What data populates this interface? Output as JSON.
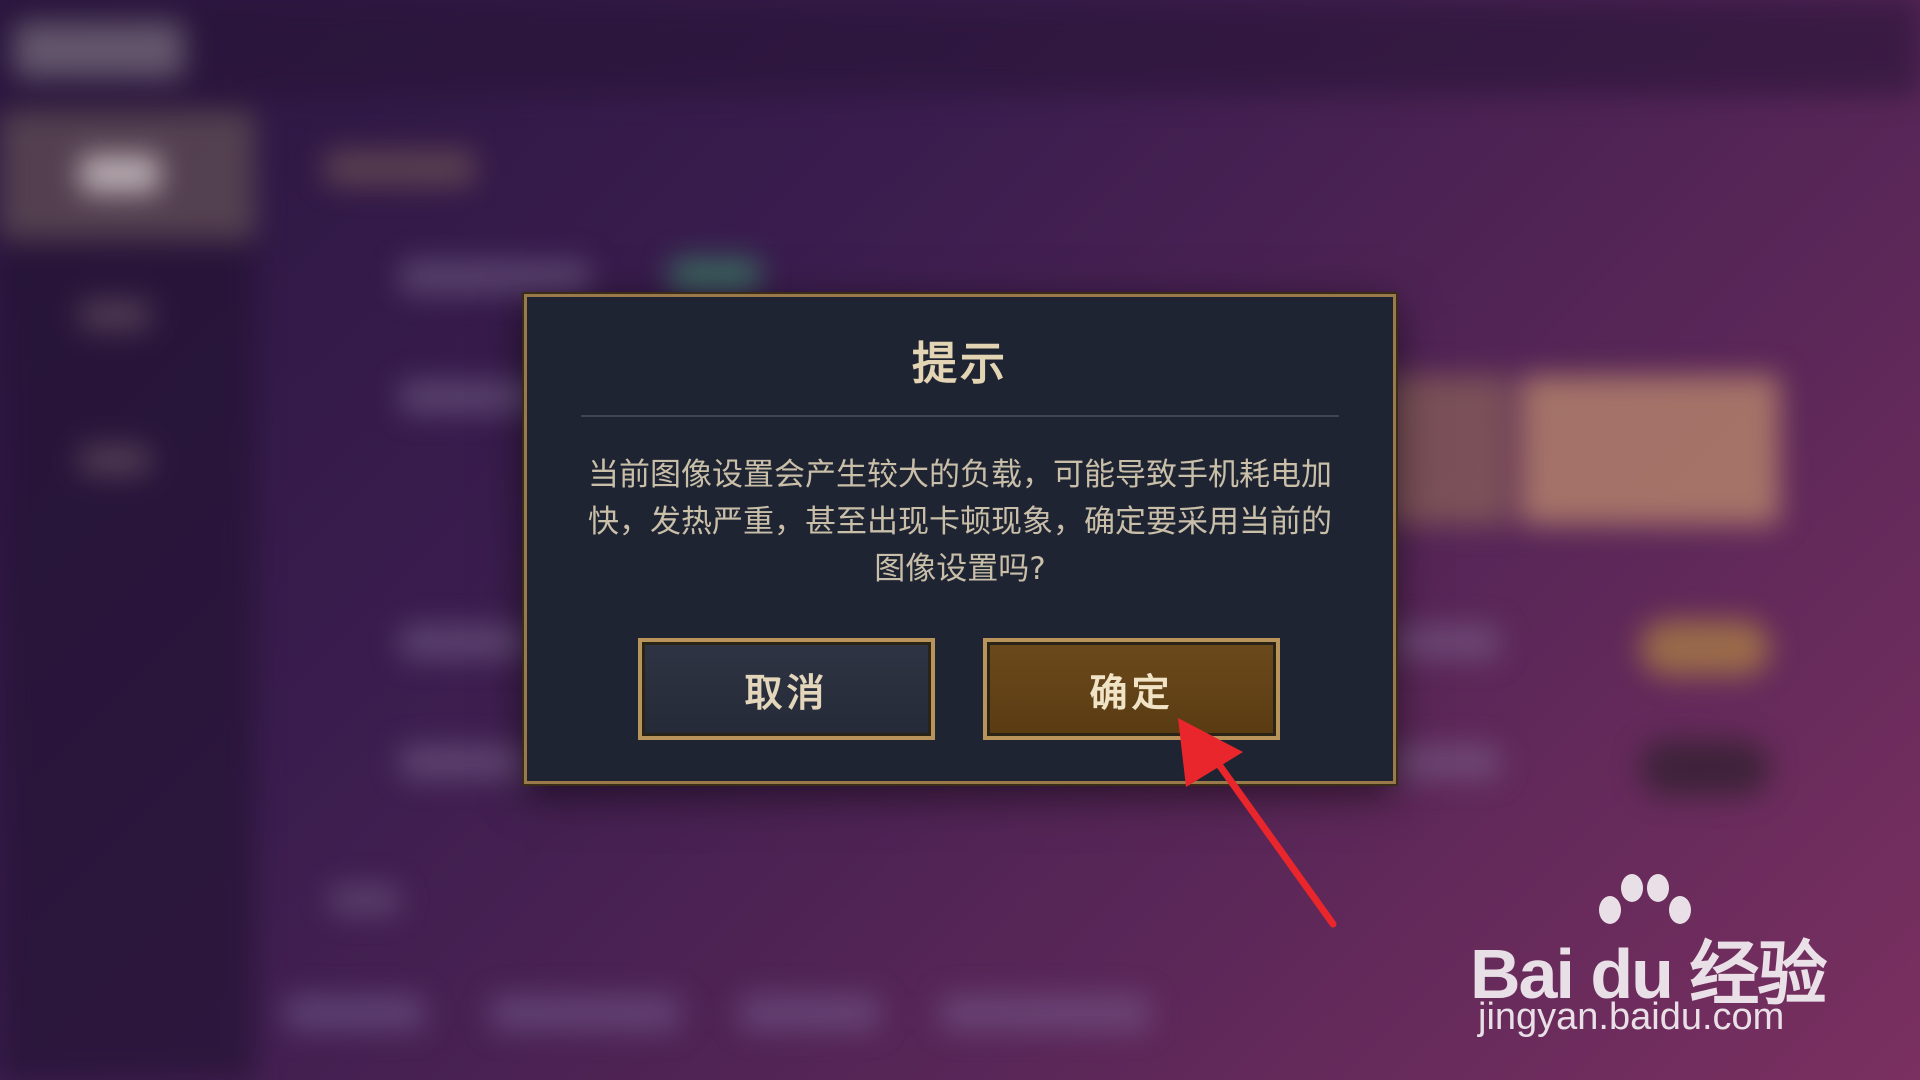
{
  "dialog": {
    "title": "提示",
    "message": "当前图像设置会产生较大的负载，可能导致手机耗电加快，发热严重，甚至出现卡顿现象，确定要采用当前的图像设置吗?",
    "cancel_label": "取消",
    "confirm_label": "确定"
  },
  "watermark": {
    "brand_logo": "Bai du 经验",
    "url": "jingyan.baidu.com"
  },
  "colors": {
    "accent_gold": "#b8945a",
    "dialog_bg": "#1f2433",
    "annotation_arrow": "#e8262b"
  }
}
